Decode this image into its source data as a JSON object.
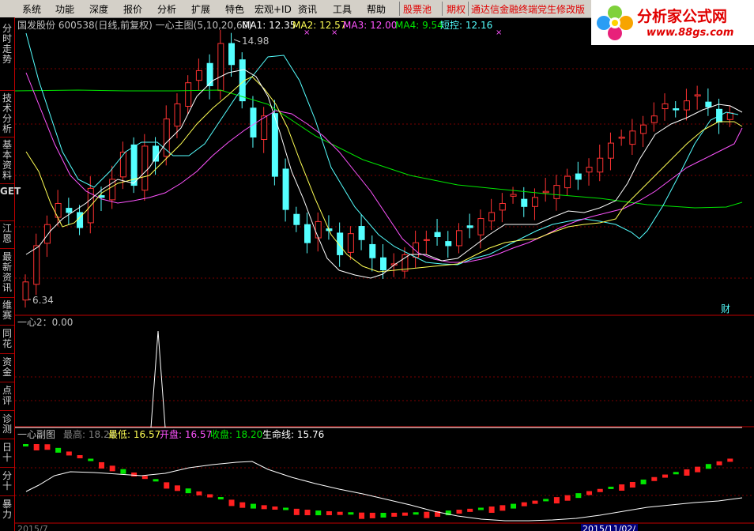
{
  "menu": {
    "items": [
      "系统",
      "功能",
      "深度",
      "报价",
      "分析",
      "扩展",
      "特色",
      "宏观+ID",
      "资讯",
      "工具",
      "帮助"
    ],
    "stock_pool": "股票池",
    "futures": "期权",
    "announcement": "通达信金融终端党生修改版"
  },
  "logo": {
    "title": "分析家公式网",
    "url": "www.88gs.com"
  },
  "sidebar": {
    "tabs": [
      "分时走势",
      "技术分析",
      "基本资料",
      "GET",
      "江恩",
      "最新资讯",
      "维赛",
      "同花",
      "资金",
      "点评",
      "诊测",
      "日十",
      "分十",
      "暴力"
    ]
  },
  "main_panel": {
    "stock_name": "国发股份",
    "stock_code": "600538",
    "period": "(日线,前复权)",
    "indicator": "一心主图(5,10,20,60)",
    "ma1_label": "MA1:",
    "ma1_value": "12.35",
    "ma2_label": "MA2:",
    "ma2_value": "12.57",
    "ma3_label": "MA3:",
    "ma3_value": "12.00",
    "ma4_label": "MA4:",
    "ma4_value": "9.54",
    "short_label": "短控:",
    "short_value": "12.16",
    "high_marker": "14.98",
    "low_marker": "6.34",
    "fin_marker": "财"
  },
  "panel2": {
    "label": "一心2：0.00"
  },
  "panel3": {
    "name": "一心副图",
    "high_label": "最高:",
    "high_value": "18.24",
    "low_label": "最低:",
    "low_value": "16.57",
    "open_label": "开盘:",
    "open_value": "16.57",
    "close_label": "收盘:",
    "close_value": "18.20",
    "life_label": "生命线:",
    "life_value": "15.76"
  },
  "bottom_axis": {
    "left_label": "2015/7",
    "date_label": "2015/11/02/"
  },
  "colors": {
    "up": "#ff3232",
    "down": "#54ffff",
    "ma1": "#ffffff",
    "ma2": "#ffff54",
    "ma3": "#ff54ff",
    "ma4": "#00e600",
    "short": "#54ffff",
    "grid": "#8b0000"
  },
  "chart_data": {
    "type": "candlestick",
    "main_series_close": [
      7.0,
      8.2,
      8.9,
      9.6,
      9.3,
      8.8,
      10.1,
      9.8,
      10.4,
      11.3,
      10.2,
      11.5,
      11.0,
      12.4,
      12.9,
      13.6,
      14.0,
      13.5,
      14.9,
      14.2,
      13.0,
      11.8,
      12.5,
      10.5,
      9.4,
      8.9,
      8.3,
      9.0,
      8.7,
      7.9,
      8.6,
      8.4,
      7.8,
      7.4,
      7.6,
      7.9,
      8.3,
      8.4,
      8.5,
      8.2,
      8.7,
      8.8,
      9.1,
      9.3,
      9.6,
      9.9,
      9.5,
      9.8,
      10.0,
      10.2,
      10.5,
      10.4,
      10.8,
      11.1,
      11.6,
      11.8,
      12.0,
      12.2,
      12.5,
      12.9,
      12.7,
      13.0,
      13.2,
      12.8,
      12.3,
      12.6
    ],
    "ma_values": {
      "MA1": 12.35,
      "MA2": 12.57,
      "MA3": 12.0,
      "MA4": 9.54,
      "short": 12.16
    },
    "price_high": 14.98,
    "price_low": 6.34
  }
}
